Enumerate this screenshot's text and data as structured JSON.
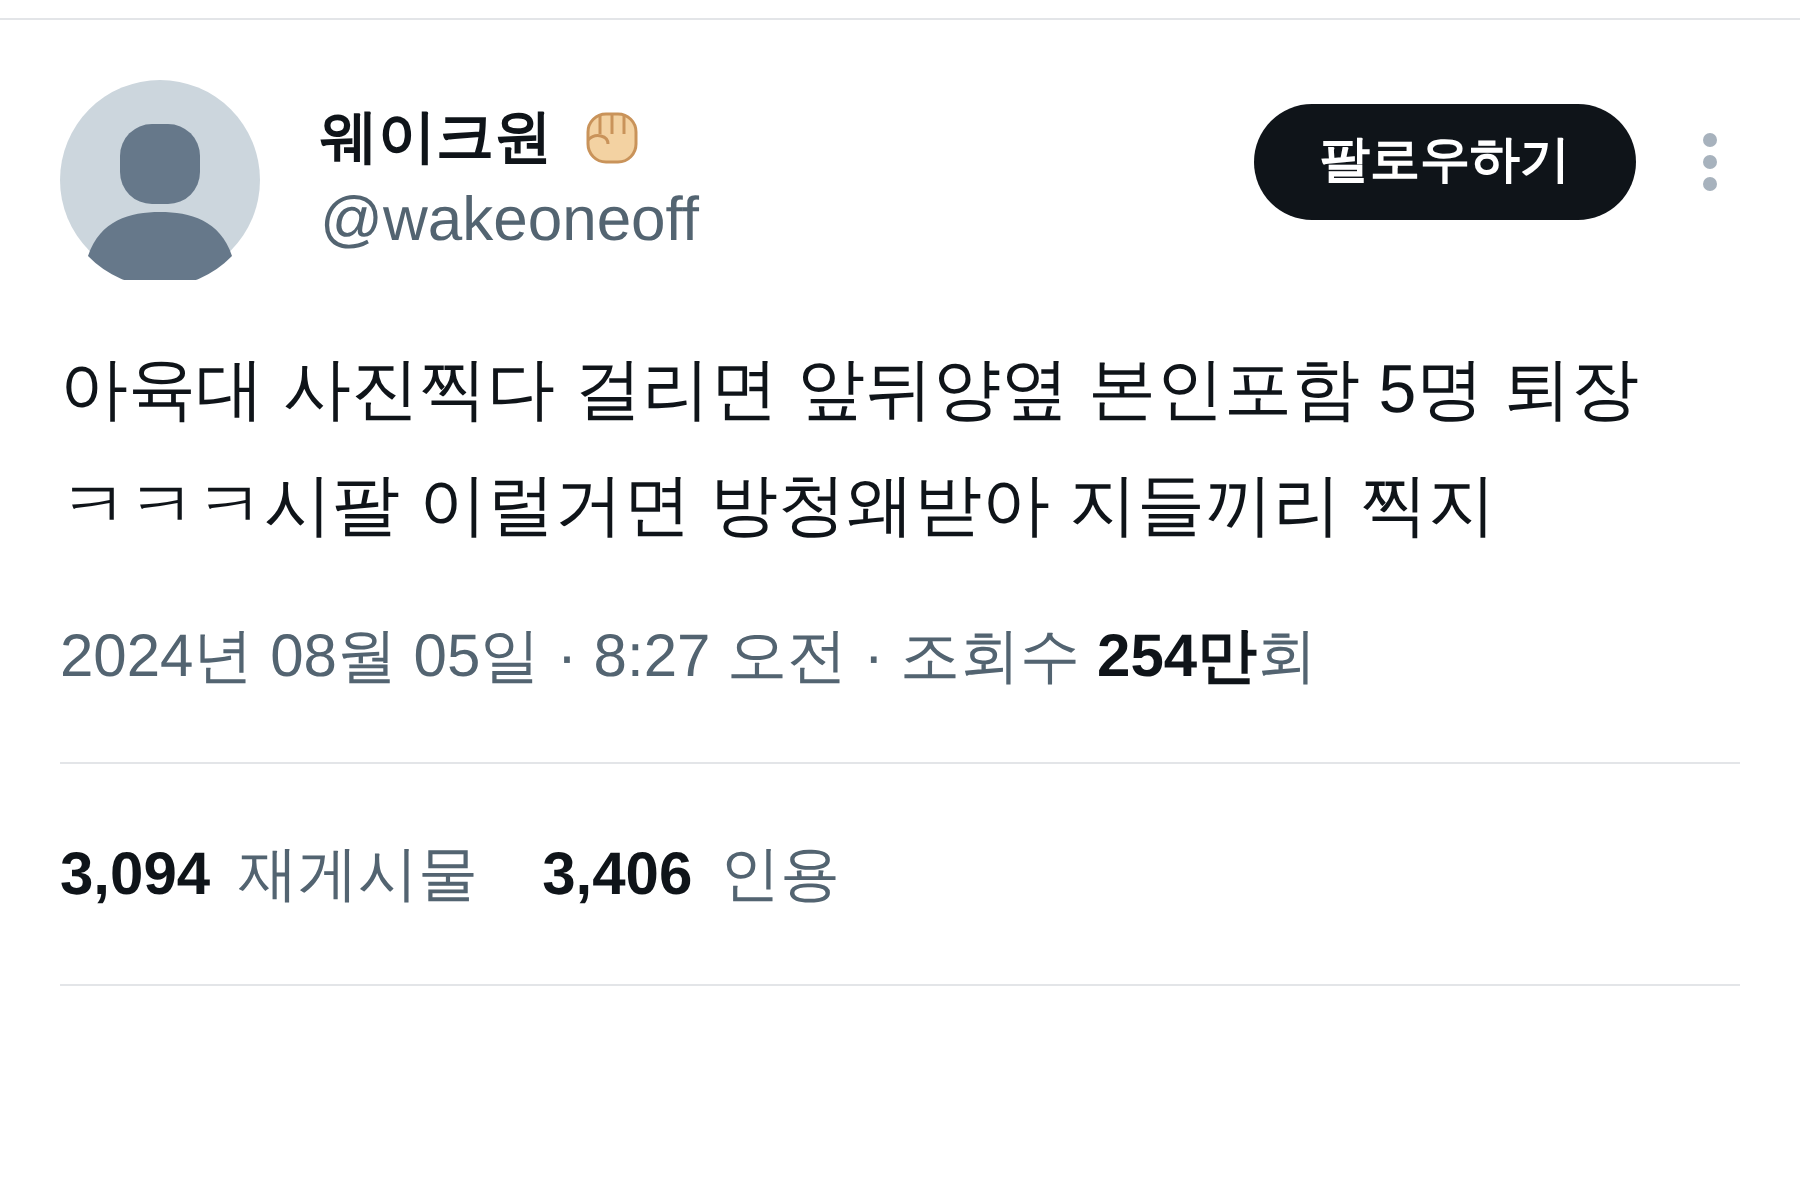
{
  "author": {
    "name": "웨이크원",
    "handle": "@wakeoneoff"
  },
  "follow_button": "팔로우하기",
  "tweet_text": "아육대 사진찍다 걸리면 앞뒤양옆 본인포함 5명 퇴장 ㅋㅋㅋ시팔 이럴거면 방청왜받아 지들끼리 찍지",
  "meta": "2024년 08월 05일 · 8:27 오전 · 조회수 **254만**회",
  "stats": [
    {
      "count": "3,094",
      "label": "재게시물"
    },
    {
      "count": "3,406",
      "label": "인용"
    }
  ]
}
